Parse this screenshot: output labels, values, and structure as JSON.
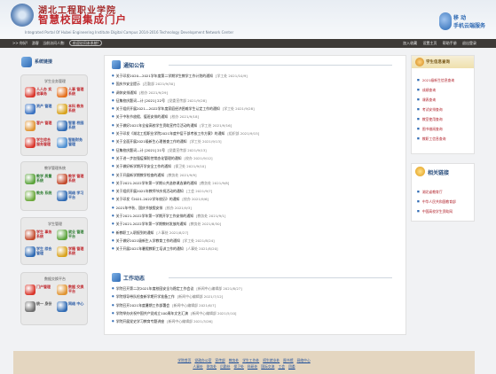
{
  "header": {
    "school_name": "湖北工程职业学院",
    "portal_title": "智慧校园集成门户",
    "school_sub": "Integrated Portal Of Hubei Engineering Institute Digital Campus  2014-2016 Technology Development   Network Center",
    "mobile_line1": "移 动",
    "mobile_line2": "手机云端服务"
  },
  "toolbar": {
    "left_items": [
      ">> 你好!",
      "游客",
      "当前访问人数:",
      "欢迎访问本系统!"
    ],
    "right_items": [
      "加入收藏",
      "设置主页",
      "帮助手册",
      "退出登录"
    ]
  },
  "sidebar": {
    "title": "系统链接",
    "groups": [
      {
        "title": "学生业务管理",
        "items": [
          {
            "label": "人人办 实验事务",
            "icon_color": "#d9362b",
            "text_color": "#c0282d"
          },
          {
            "label": "人事 管理系统",
            "icon_color": "#e46f1c",
            "text_color": "#c0282d"
          },
          {
            "label": "资产 管理",
            "icon_color": "#3a72c1",
            "text_color": "#2f5fa8"
          },
          {
            "label": "本科 教务系统",
            "icon_color": "#d8a21c",
            "text_color": "#c0282d"
          },
          {
            "label": "客户 管理",
            "icon_color": "#e09432",
            "text_color": "#c0282d"
          },
          {
            "label": "智慧 校园系统",
            "icon_color": "#2f6ab3",
            "text_color": "#2f5fa8"
          },
          {
            "label": "学生综合 服务管理",
            "icon_color": "#d9362b",
            "text_color": "#c0282d"
          },
          {
            "label": "智能财务 管理",
            "icon_color": "#4d8fd1",
            "text_color": "#2f5fa8"
          }
        ]
      },
      {
        "title": "教学管理系统",
        "items": [
          {
            "label": "教学 质量系统",
            "icon_color": "#5aa33b",
            "text_color": "#2e7d32"
          },
          {
            "label": "教学 管理系统",
            "icon_color": "#c34a2c",
            "text_color": "#c0282d"
          },
          {
            "label": "教务 系统",
            "icon_color": "#6ba83a",
            "text_color": "#2e7d32"
          },
          {
            "label": "网络 学习平台",
            "icon_color": "#2f6ab3",
            "text_color": "#2f5fa8"
          }
        ]
      },
      {
        "title": "学生管理",
        "items": [
          {
            "label": "学生 事务系统",
            "icon_color": "#c34a2c",
            "text_color": "#c0282d"
          },
          {
            "label": "就业 管理平台",
            "icon_color": "#5aa33b",
            "text_color": "#2e7d32"
          },
          {
            "label": "学生 综合管理",
            "icon_color": "#2f6ab3",
            "text_color": "#2f5fa8"
          },
          {
            "label": "学籍 管理系统",
            "icon_color": "#d8a21c",
            "text_color": "#c0282d"
          }
        ]
      },
      {
        "title": "数据交换平台",
        "items": [
          {
            "label": "门户管理",
            "icon_color": "#d9362b",
            "text_color": "#c0282d"
          },
          {
            "label": "数据 交换平台",
            "icon_color": "#e09432",
            "text_color": "#c0282d"
          },
          {
            "label": "统一 身份",
            "icon_color": "#6e6e6e",
            "text_color": "#555"
          },
          {
            "label": "网络 中心",
            "icon_color": "#2f6ab3",
            "text_color": "#2f5fa8"
          }
        ]
      }
    ]
  },
  "notice": {
    "title": "通知公告",
    "items": [
      {
        "text": "关于印发2020—2021学年度第二学期学生教学工作计划的通知",
        "date": "[学工处  2021/10/9]"
      },
      {
        "text": "国庆节安全提示",
        "date": "[后勤部  2021/9/30]"
      },
      {
        "text": "调休安排通知",
        "date": "[校办  2021/9/29]"
      },
      {
        "text": "征集校庆题词—计 [2021] 22号",
        "date": "[党委宣传部  2021/9/28]"
      },
      {
        "text": "关于组织开展2021—2022学年度家庭经济困难学生认定工作的通知",
        "date": "[学工处  2021/9/28]"
      },
      {
        "text": "关于中秋节放假、值班安排的通知",
        "date": "[校办  2021/9/18]"
      },
      {
        "text": "关于做好2021年全省高校学生资助宣传月活动的通知",
        "date": "[学工处  2021/9/16]"
      },
      {
        "text": "关于印发《湖北工程职业学院2021年度中层干部考核工作方案》的通知",
        "date": "[组织部  2021/9/15]"
      },
      {
        "text": "关于全面开展2021级新生心理普查工作的通知",
        "date": "[学工处  2021/9/13]"
      },
      {
        "text": "征集校庆题词—计 [2021] 21号",
        "date": "[党委宣传部  2021/9/13]"
      },
      {
        "text": "关于进一步加强疫情防控常态化管理的通知",
        "date": "[校办  2021/9/12]"
      },
      {
        "text": "关于做好新学期开学安全工作的通知",
        "date": "[保卫处  2021/9/10]"
      },
      {
        "text": "关于开展新学期教学检查的通知",
        "date": "[教务处  2021/9/9]"
      },
      {
        "text": "关于2021-2022学年第一学期公共选修课选课的通知",
        "date": "[教务处  2021/9/8]"
      },
      {
        "text": "关于组织开展2021年教师节庆祝活动的通知",
        "date": "[工会  2021/9/7]"
      },
      {
        "text": "关于印发《2021-2022学年校历》的通知",
        "date": "[校办  2021/9/6]"
      },
      {
        "text": "2021年中秋、国庆节放假安排",
        "date": "[校办  2021/9/3]"
      },
      {
        "text": "关于2021-2022学年第一学期开学工作安排的通知",
        "date": "[教务处  2021/9/1]"
      },
      {
        "text": "关于2021-2022学年第一学期教材发放的通知",
        "date": "[教务处  2021/8/30]"
      },
      {
        "text": "新教职工入职报到的通知",
        "date": "[人事处  2021/8/27]"
      },
      {
        "text": "关于做好2021级新生入学教育工作的通知",
        "date": "[学工处  2021/8/24]"
      },
      {
        "text": "关于开展2021年暑假教职工培训工作的通知",
        "date": "[人事处  2021/8/20]"
      }
    ]
  },
  "work": {
    "title": "工作动态",
    "items": [
      {
        "text": "学院召开第二次2021年度校园安全与稳定工作会议",
        "date": "[新闻中心编辑部  2021/8/27]"
      },
      {
        "text": "学院领导带队检查新学期开学准备工作",
        "date": "[新闻中心编辑部  2021/7/12]"
      },
      {
        "text": "学院召开2021年度暑期工作部署会",
        "date": "[新闻中心编辑部  2021/6/7]"
      },
      {
        "text": "学院举办庆祝中国共产党成立100周年文艺汇演",
        "date": "[新闻中心编辑部  2021/5/10]"
      },
      {
        "text": "学院开展党史学习教育专题讲座",
        "date": "[新闻中心编辑部  2021/3/26]"
      }
    ]
  },
  "right_menu": {
    "title": "学生信息查询",
    "items": [
      "2021级新生信息查询",
      "成绩查询",
      "课表查询",
      "考试安排查询",
      "教室使用查询",
      "图书借阅查询",
      "教职工信息查询"
    ]
  },
  "related_links": {
    "title": "相关链接",
    "items": [
      "湖北省教育厅",
      "中华人民共和国教育部",
      "中国高校学生资助网"
    ]
  },
  "footer": {
    "row1": [
      "学院首页",
      "党政办公室",
      "宣传部",
      "教务处",
      "学生工作处",
      "招生就业处",
      "图书馆",
      "网络中心"
    ],
    "row2": [
      "人事处",
      "财务处",
      "后勤处",
      "保卫处",
      "科研处",
      "国际交流",
      "工会",
      "团委"
    ]
  }
}
